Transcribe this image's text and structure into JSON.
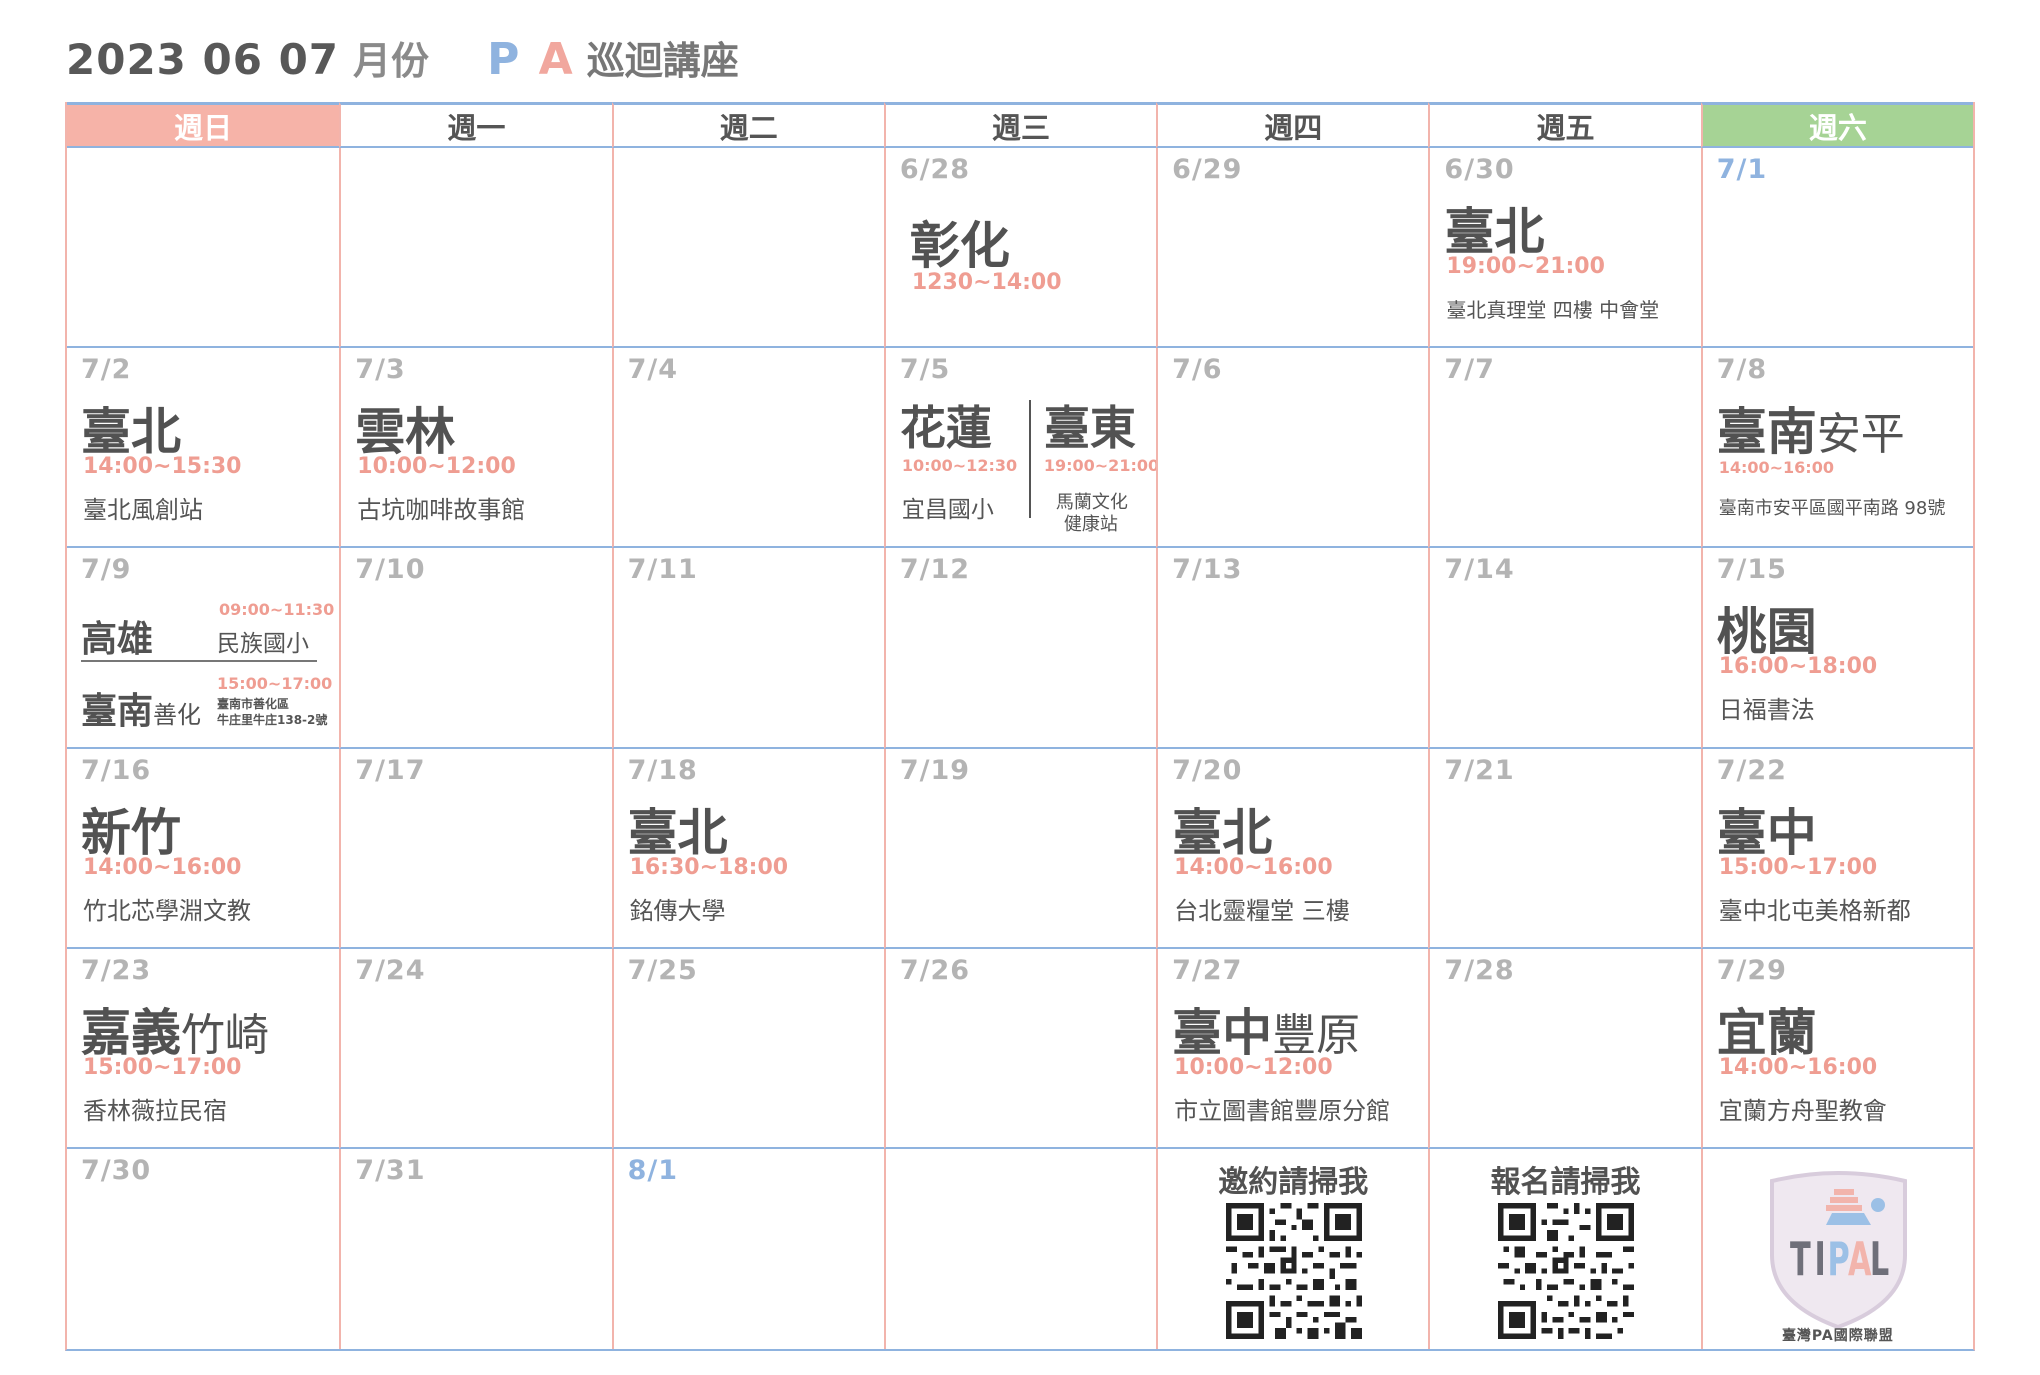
{
  "header": {
    "date": "2023 06 07",
    "unit": "月份",
    "brand_p": "P",
    "brand_a": "A",
    "title": "巡迴講座"
  },
  "weekdays": [
    "週日",
    "週一",
    "週二",
    "週三",
    "週四",
    "週五",
    "週六"
  ],
  "w1": {
    "d628": "6/28",
    "d629": "6/29",
    "d630": "6/30",
    "d71": "7/1",
    "e628": {
      "city": "彰化",
      "time": "1230~14:00"
    },
    "e630": {
      "city": "臺北",
      "time": "19:00~21:00",
      "venue": "臺北真理堂 四樓 中會堂"
    }
  },
  "w2": {
    "d72": "7/2",
    "d73": "7/3",
    "d74": "7/4",
    "d75": "7/5",
    "d76": "7/6",
    "d77": "7/7",
    "d78": "7/8",
    "e72": {
      "city": "臺北",
      "time": "14:00~15:30",
      "venue": "臺北風創站"
    },
    "e73": {
      "city": "雲林",
      "time": "10:00~12:00",
      "venue": "古坑咖啡故事館"
    },
    "e75a": {
      "city": "花蓮",
      "time": "10:00~12:30",
      "venue": "宜昌國小"
    },
    "e75b": {
      "city": "臺東",
      "time": "19:00~21:00",
      "venue1": "馬蘭文化",
      "venue2": "健康站"
    },
    "e78": {
      "city": "臺南",
      "sub": "安平",
      "time": "14:00~16:00",
      "venue": "臺南市安平區國平南路 98號"
    }
  },
  "w3": {
    "d79": "7/9",
    "d710": "7/10",
    "d711": "7/11",
    "d712": "7/12",
    "d713": "7/13",
    "d714": "7/14",
    "d715": "7/15",
    "e79a": {
      "city": "高雄",
      "time": "09:00~11:30",
      "venue": "民族國小"
    },
    "e79b": {
      "city": "臺南",
      "sub": "善化",
      "time": "15:00~17:00",
      "venue1": "臺南市善化區",
      "venue2": "牛庄里牛庄138-2號"
    },
    "e715": {
      "city": "桃園",
      "time": "16:00~18:00",
      "venue": "日福書法"
    }
  },
  "w4": {
    "d716": "7/16",
    "d717": "7/17",
    "d718": "7/18",
    "d719": "7/19",
    "d720": "7/20",
    "d721": "7/21",
    "d722": "7/22",
    "e716": {
      "city": "新竹",
      "time": "14:00~16:00",
      "venue": "竹北芯學淵文教"
    },
    "e718": {
      "city": "臺北",
      "time": "16:30~18:00",
      "venue": "銘傳大學"
    },
    "e720": {
      "city": "臺北",
      "time": "14:00~16:00",
      "venue": "台北靈糧堂 三樓"
    },
    "e722": {
      "city": "臺中",
      "time": "15:00~17:00",
      "venue": "臺中北屯美格新都"
    }
  },
  "w5": {
    "d723": "7/23",
    "d724": "7/24",
    "d725": "7/25",
    "d726": "7/26",
    "d727": "7/27",
    "d728": "7/28",
    "d729": "7/29",
    "e723": {
      "city": "嘉義",
      "sub": "竹崎",
      "time": "15:00~17:00",
      "venue": "香林薇拉民宿"
    },
    "e727": {
      "city": "臺中",
      "sub": "豐原",
      "time": "10:00~12:00",
      "venue": "市立圖書館豐原分館"
    },
    "e729": {
      "city": "宜蘭",
      "time": "14:00~16:00",
      "venue": "宜蘭方舟聖教會"
    }
  },
  "w6": {
    "d730": "7/30",
    "d731": "7/31",
    "d81": "8/1",
    "qr_invite": "邀約請掃我",
    "qr_register": "報名請掃我",
    "logo_text": "TIPAL",
    "org_name": "臺灣PA國際聯盟"
  },
  "colors": {
    "sunday": "#f6b3a8",
    "saturday": "#a6d395",
    "time": "#ef9d92",
    "grid_blue": "#8fb3df",
    "grid_pink": "#f2b4ac"
  }
}
